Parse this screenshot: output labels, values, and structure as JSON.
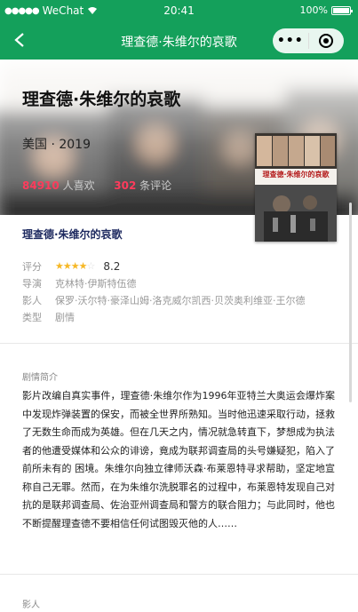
{
  "status_bar": {
    "carrier": "WeChat",
    "time": "20:41",
    "battery": "100%"
  },
  "nav": {
    "title": "理查德·朱维尔的哀歌",
    "more_label": "•••"
  },
  "hero": {
    "title": "理查德·朱维尔的哀歌",
    "meta": "美国 · 2019",
    "likes_count": "84910",
    "likes_label": "人喜欢",
    "comments_count": "302",
    "comments_label": "条评论"
  },
  "info": {
    "title": "理查德·朱维尔的哀歌",
    "rows": [
      {
        "key": "评分",
        "value": "8.2"
      },
      {
        "key": "导演",
        "value": "克林特·伊斯特伍德"
      },
      {
        "key": "影人",
        "value": "保罗·沃尔特·豪泽山姆·洛克威尔凯西·贝茨奥利维亚·王尔德"
      },
      {
        "key": "类型",
        "value": "剧情"
      }
    ],
    "rating_stars": 4,
    "rating_max": 5
  },
  "synopsis": {
    "label": "剧情简介",
    "text": "影片改编自真实事件，理查德·朱维尔作为1996年亚特兰大奥运会爆炸案中发现炸弹装置的保安，而被全世界所熟知。当时他迅速采取行动，拯救了无数生命而成为英雄。但在几天之内，情况就急转直下，梦想成为执法者的他遭受媒体和公众的诽谤，竟成为联邦调查局的头号嫌疑犯，陷入了前所未有的 困境。朱维尔向独立律师沃森·布莱恩特寻求帮助，坚定地宣称自己无罪。然而，在为朱维尔洗脱罪名的过程中，布莱恩特发现自己对抗的是联邦调查局、佐治亚州调查局和警方的联合阻力；与此同时，他也不断提醒理查德不要相信任何试图毁灭他的人……"
  },
  "cast_section": {
    "label": "影人"
  },
  "colors": {
    "brand": "#14a05b",
    "accent_red": "#ff3b5c",
    "star": "#f6b827"
  }
}
